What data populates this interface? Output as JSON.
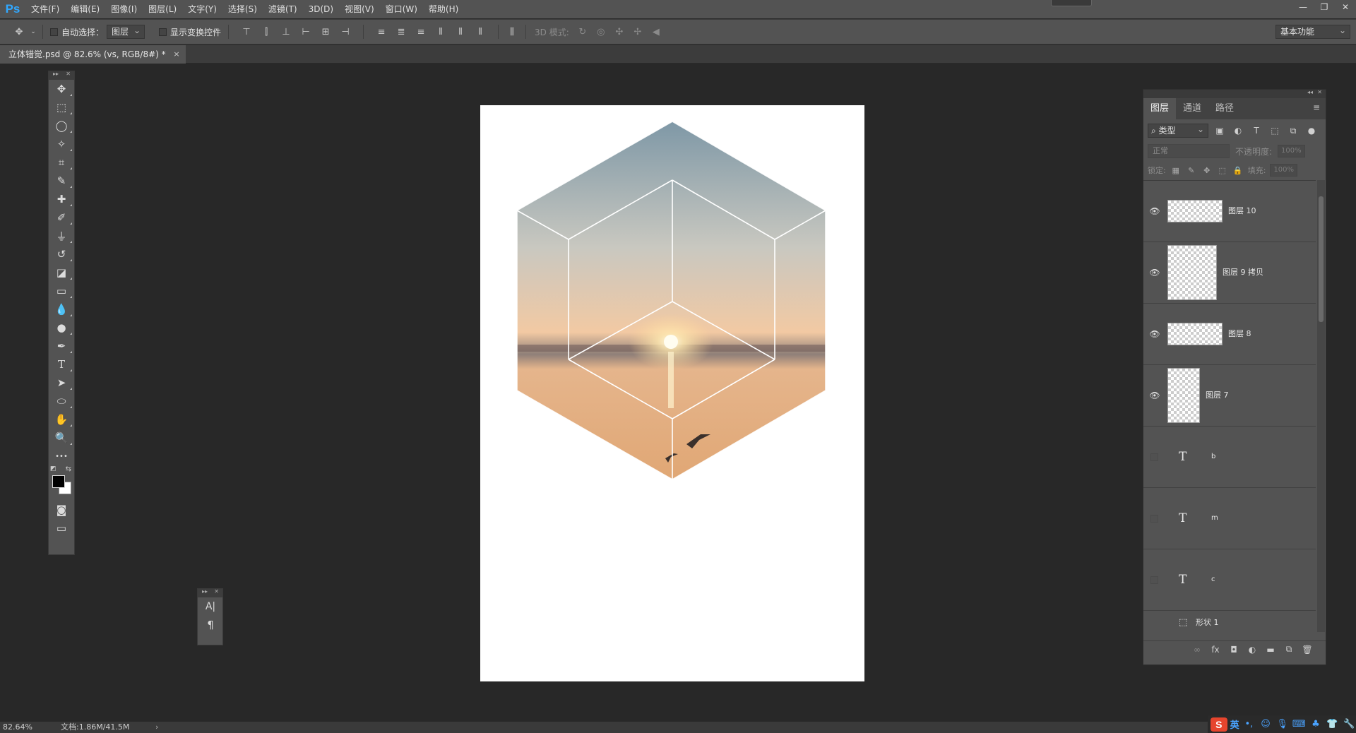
{
  "app": {
    "logo": "Ps",
    "menu": [
      "文件(F)",
      "编辑(E)",
      "图像(I)",
      "图层(L)",
      "文字(Y)",
      "选择(S)",
      "滤镜(T)",
      "3D(D)",
      "视图(V)",
      "窗口(W)",
      "帮助(H)"
    ],
    "window_controls": {
      "minimize": "—",
      "restore": "❐",
      "close": "✕"
    }
  },
  "options_bar": {
    "move_icon": "move-icon",
    "auto_select_label": "自动选择：",
    "auto_select_value": "图层",
    "show_transform_label": "显示变换控件",
    "mode3d_label": "3D 模式:",
    "workspace": "基本功能"
  },
  "document": {
    "tab_title": "立体错觉.psd @ 82.6% (vs, RGB/8#) *",
    "close": "×"
  },
  "tools": [
    {
      "name": "move-tool",
      "glyph": "✥"
    },
    {
      "name": "marquee-tool",
      "glyph": "⬚"
    },
    {
      "name": "lasso-tool",
      "glyph": "◯"
    },
    {
      "name": "magic-wand-tool",
      "glyph": "✧"
    },
    {
      "name": "crop-tool",
      "glyph": "⌗"
    },
    {
      "name": "eyedropper-tool",
      "glyph": "✎"
    },
    {
      "name": "healing-brush-tool",
      "glyph": "✚"
    },
    {
      "name": "brush-tool",
      "glyph": "✐"
    },
    {
      "name": "clone-stamp-tool",
      "glyph": "⏚"
    },
    {
      "name": "history-brush-tool",
      "glyph": "↺"
    },
    {
      "name": "eraser-tool",
      "glyph": "◪"
    },
    {
      "name": "gradient-tool",
      "glyph": "▭"
    },
    {
      "name": "blur-tool",
      "glyph": "💧"
    },
    {
      "name": "dodge-tool",
      "glyph": "●"
    },
    {
      "name": "pen-tool",
      "glyph": "✒"
    },
    {
      "name": "type-tool",
      "glyph": "T"
    },
    {
      "name": "path-selection-tool",
      "glyph": "➤"
    },
    {
      "name": "ellipse-tool",
      "glyph": "⬭"
    },
    {
      "name": "hand-tool",
      "glyph": "✋"
    },
    {
      "name": "zoom-tool",
      "glyph": "🔍"
    },
    {
      "name": "more-tools",
      "glyph": "•••"
    }
  ],
  "char_panel": {
    "char_icon": "A|",
    "para_icon": "¶"
  },
  "layers_panel": {
    "tabs": [
      "图层",
      "通道",
      "路径"
    ],
    "filter_kind": "类型",
    "blend_mode": "正常",
    "opacity_label": "不透明度:",
    "opacity_value": "100%",
    "lock_label": "锁定:",
    "fill_label": "填充:",
    "fill_value": "100%",
    "layers": [
      {
        "name": "图层 10",
        "visible": true,
        "kind": "pixel"
      },
      {
        "name": "图层 9 拷贝",
        "visible": true,
        "kind": "pixel"
      },
      {
        "name": "图层 8",
        "visible": true,
        "kind": "pixel"
      },
      {
        "name": "图层 7",
        "visible": true,
        "kind": "pixel"
      },
      {
        "name": "b",
        "visible": false,
        "kind": "text"
      },
      {
        "name": "m",
        "visible": false,
        "kind": "text"
      },
      {
        "name": "c",
        "visible": false,
        "kind": "text"
      },
      {
        "name": "形状 1",
        "visible": false,
        "kind": "shape"
      }
    ],
    "scroll_position": 0.05
  },
  "status": {
    "zoom": "82.64%",
    "doc_size": "文档:1.86M/41.5M",
    "arrow": "›"
  },
  "ime": {
    "logo": "S",
    "lang": "英"
  },
  "colors": {
    "sky_top": "#7d97a6",
    "horizon": "#f2c9a3",
    "water": "#e0a673",
    "foreground": "#000000",
    "background": "#ffffff"
  }
}
